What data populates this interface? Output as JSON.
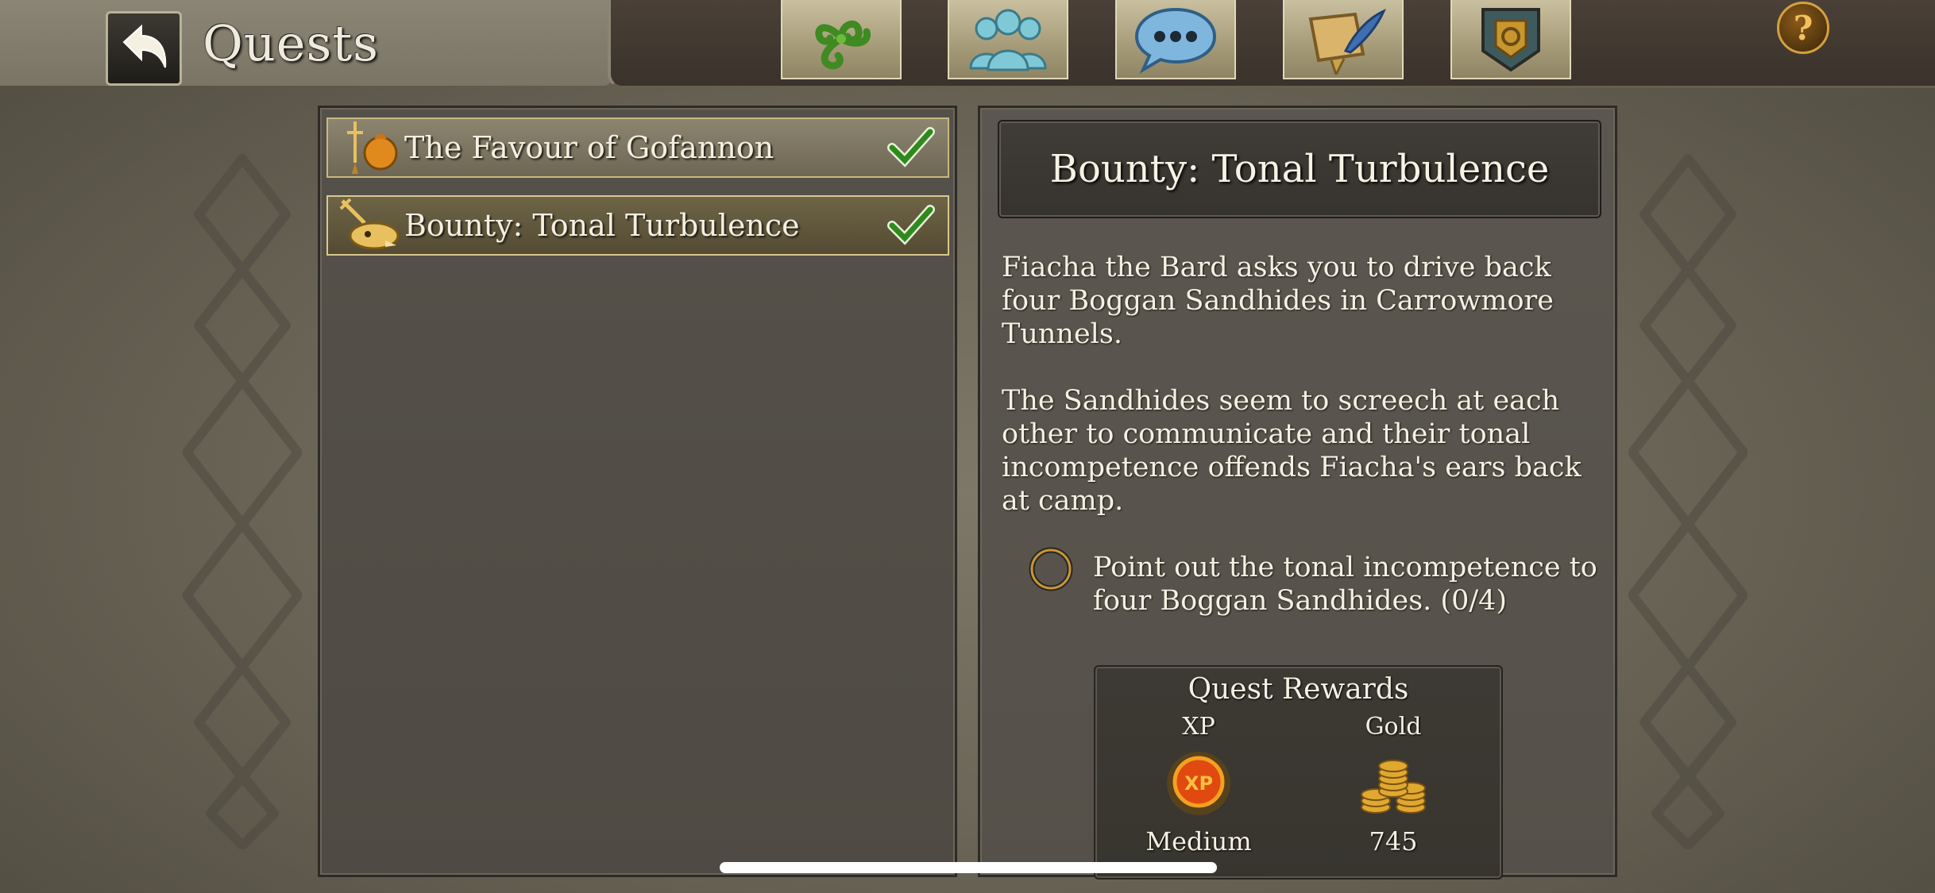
{
  "header": {
    "title": "Quests",
    "help_symbol": "?"
  },
  "nav": {
    "items": [
      {
        "icon": "triskele-icon"
      },
      {
        "icon": "party-icon"
      },
      {
        "icon": "chat-icon"
      },
      {
        "icon": "scroll-quill-icon"
      },
      {
        "icon": "guild-shield-icon"
      }
    ]
  },
  "quests": {
    "items": [
      {
        "label": "The Favour of Gofannon",
        "icon": "sword-pouch-icon",
        "completed_check": true,
        "selected": false
      },
      {
        "label": "Bounty: Tonal Turbulence",
        "icon": "bounty-skull-icon",
        "completed_check": true,
        "selected": true
      }
    ]
  },
  "detail": {
    "title": "Bounty: Tonal Turbulence",
    "description_1": "Fiacha the Bard asks you to drive back four Boggan Sandhides in Carrowmore Tunnels.",
    "description_2": "The Sandhides seem to screech at each other to communicate and their tonal incompetence offends Fiacha's ears back at camp.",
    "objective": "Point out the tonal incompetence to four Boggan Sandhides. (0/4)",
    "objective_progress": {
      "done": 0,
      "total": 4
    }
  },
  "rewards": {
    "title": "Quest Rewards",
    "xp_label": "XP",
    "xp_value": "Medium",
    "gold_label": "Gold",
    "gold_value": "745"
  },
  "colors": {
    "accent_gold": "#d4a040",
    "check_green": "#2f8a1e",
    "text_light": "#f4f0e2"
  }
}
